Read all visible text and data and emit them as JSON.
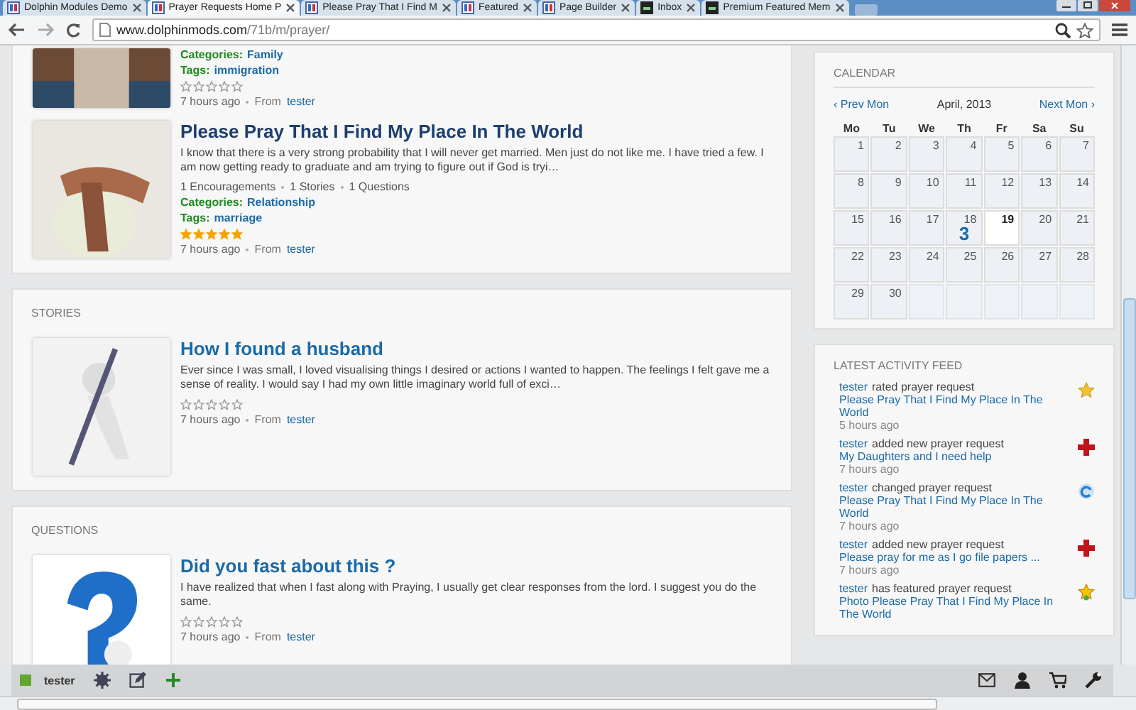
{
  "browser": {
    "tabs": [
      {
        "label": "Dolphin Modules Demo",
        "selected": false
      },
      {
        "label": "Prayer Requests Home P",
        "selected": true
      },
      {
        "label": "Please Pray That I Find M",
        "selected": false
      },
      {
        "label": "Featured",
        "selected": false
      },
      {
        "label": "Page Builder",
        "selected": false
      },
      {
        "label": "Inbox",
        "selected": false
      },
      {
        "label": "Premium Featured Mem",
        "selected": false
      }
    ],
    "url_host": "www.dolphinmods.com",
    "url_path": "/71b/m/prayer/"
  },
  "sections": [
    {
      "items": [
        {
          "categories_label": "Categories:",
          "category": "Family",
          "tags_label": "Tags:",
          "tag": "immigration",
          "stars": 0,
          "time": "7 hours ago",
          "from_label": "From",
          "author": "tester"
        },
        {
          "title": "Please Pray That I Find My Place In The World",
          "excerpt": "I know that there is a very strong probability that I will never get married. Men just do not like me. I have tried a few. I am now getting ready to graduate and am trying to figure out if God is tryi…",
          "counts": [
            "1 Encouragements",
            "1 Stories",
            "1 Questions"
          ],
          "categories_label": "Categories:",
          "category": "Relationship",
          "tags_label": "Tags:",
          "tag": "marriage",
          "stars": 5,
          "time": "7 hours ago",
          "from_label": "From",
          "author": "tester"
        }
      ]
    },
    {
      "heading": "STORIES",
      "items": [
        {
          "title": "How I found a husband",
          "excerpt": "Ever since I was small, I loved visualising things I desired or actions I wanted to happen. The feelings I felt gave me a sense of reality. I would say I had my own little imaginary world full of exci…",
          "stars": 0,
          "time": "7 hours ago",
          "from_label": "From",
          "author": "tester"
        }
      ]
    },
    {
      "heading": "QUESTIONS",
      "items": [
        {
          "title": "Did you fast about this ?",
          "excerpt": "I have realized that when I fast along with Praying, I usually get clear responses from the lord. I suggest you do the same.",
          "stars": 0,
          "time": "7 hours ago",
          "from_label": "From",
          "author": "tester"
        }
      ]
    }
  ],
  "calendar": {
    "heading": "CALENDAR",
    "prev": "‹ Prev Mon",
    "month": "April, 2013",
    "next": "Next Mon ›",
    "weekdays": [
      "Mo",
      "Tu",
      "We",
      "Th",
      "Fr",
      "Sa",
      "Su"
    ],
    "days": [
      {
        "day": "1"
      },
      {
        "day": "2"
      },
      {
        "day": "3"
      },
      {
        "day": "4"
      },
      {
        "day": "5"
      },
      {
        "day": "6"
      },
      {
        "day": "7"
      },
      {
        "day": "8"
      },
      {
        "day": "9"
      },
      {
        "day": "10"
      },
      {
        "day": "11"
      },
      {
        "day": "12"
      },
      {
        "day": "13"
      },
      {
        "day": "14"
      },
      {
        "day": "15"
      },
      {
        "day": "16"
      },
      {
        "day": "17"
      },
      {
        "day": "18",
        "count": "3"
      },
      {
        "day": "19",
        "today": true
      },
      {
        "day": "20"
      },
      {
        "day": "21"
      },
      {
        "day": "22"
      },
      {
        "day": "23"
      },
      {
        "day": "24"
      },
      {
        "day": "25"
      },
      {
        "day": "26"
      },
      {
        "day": "27"
      },
      {
        "day": "28"
      },
      {
        "day": "29"
      },
      {
        "day": "30"
      }
    ]
  },
  "activity": {
    "heading": "LATEST ACTIVITY FEED",
    "items": [
      {
        "kind": "rated",
        "user": "tester",
        "action": "rated prayer request",
        "target": "Please Pray That I Find My Place In The World",
        "time": "5 hours ago"
      },
      {
        "kind": "added",
        "user": "tester",
        "action": "added new prayer request",
        "target": "My Daughters and I need help",
        "time": "7 hours ago"
      },
      {
        "kind": "changed",
        "user": "tester",
        "action": "changed prayer request",
        "target": "Please Pray That I Find My Place In The World",
        "time": "7 hours ago"
      },
      {
        "kind": "added",
        "user": "tester",
        "action": "added new prayer request",
        "target": "Please pray for me as I go file papers ...",
        "time": "7 hours ago"
      },
      {
        "kind": "featured",
        "user": "tester",
        "action": "has featured prayer request",
        "target": "Photo Please Pray That I Find My Place In The World"
      }
    ]
  },
  "toolbar": {
    "user": "tester"
  }
}
